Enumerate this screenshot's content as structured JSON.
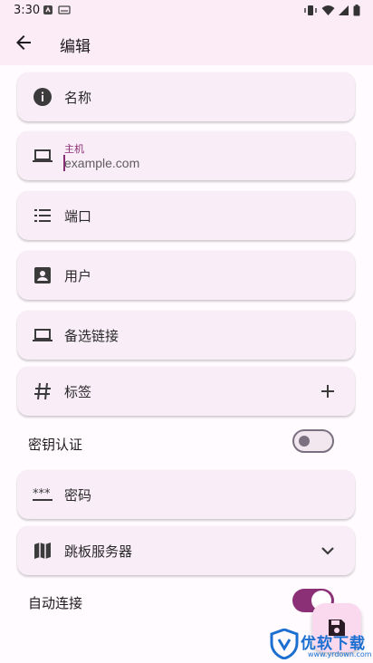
{
  "status_bar": {
    "time": "3:30"
  },
  "app_bar": {
    "title": "编辑"
  },
  "fields": {
    "name": {
      "label": "名称",
      "icon": "info-icon"
    },
    "host": {
      "label": "主机",
      "value": "example.com",
      "icon": "laptop-icon"
    },
    "port": {
      "label": "端口",
      "icon": "list-icon"
    },
    "user": {
      "label": "用户",
      "icon": "contact-icon"
    },
    "alt_link": {
      "label": "备选链接",
      "icon": "laptop-icon"
    },
    "tags": {
      "label": "标签",
      "icon": "hash-icon",
      "trailing_icon": "plus-icon"
    },
    "password": {
      "label": "密码",
      "icon": "password-icon"
    },
    "jump_server": {
      "label": "跳板服务器",
      "icon": "map-icon",
      "trailing_icon": "chevron-down-icon"
    }
  },
  "key_auth": {
    "label": "密钥认证",
    "enabled": false
  },
  "auto_connect": {
    "label": "自动连接",
    "enabled": true
  },
  "fab": {
    "icon": "save-icon"
  },
  "watermark": {
    "text": "优软下载",
    "subtext": "www.yrdown.com"
  },
  "colors": {
    "accent": "#8b2f76",
    "surface": "#f9edf7",
    "appbar": "#fcecf6",
    "fab": "#fad8ee"
  }
}
